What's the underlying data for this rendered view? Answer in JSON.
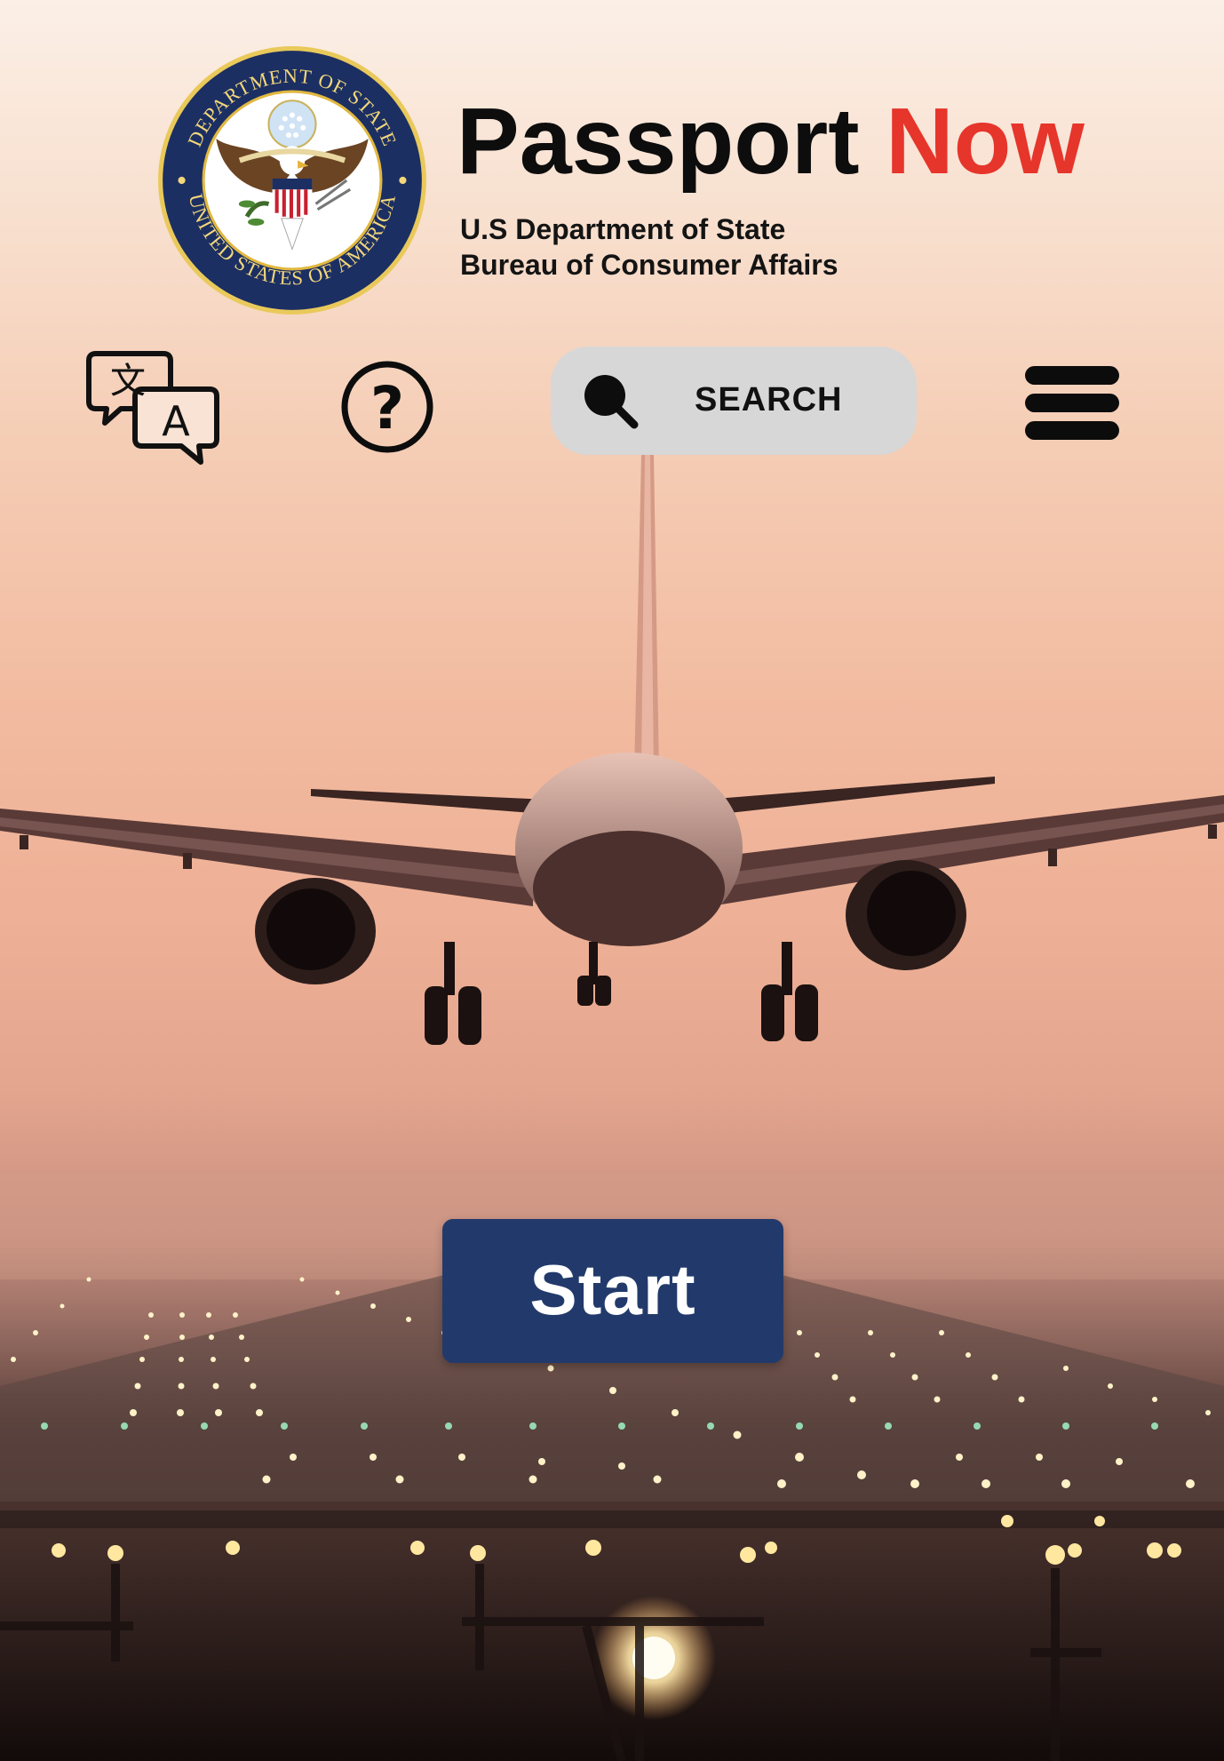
{
  "header": {
    "title_main": "Passport",
    "title_accent": "Now",
    "subtitle_line1": "U.S Department of State",
    "subtitle_line2": "Bureau of Consumer Affairs",
    "seal_text_top": "DEPARTMENT OF STATE",
    "seal_text_bottom": "UNITED STATES OF AMERICA"
  },
  "toolbar": {
    "translate_icon": "translate-icon",
    "translate_glyph_left": "文",
    "translate_glyph_right": "A",
    "help_icon": "help-circle-icon",
    "help_glyph": "?",
    "search_icon": "search-icon",
    "search_label": "SEARCH",
    "menu_icon": "hamburger-menu-icon"
  },
  "main": {
    "start_label": "Start"
  },
  "colors": {
    "accent": "#e6352b",
    "start_button": "#223a6b",
    "search_bg": "#d7d7d7",
    "text_dark": "#0d0d0d"
  }
}
